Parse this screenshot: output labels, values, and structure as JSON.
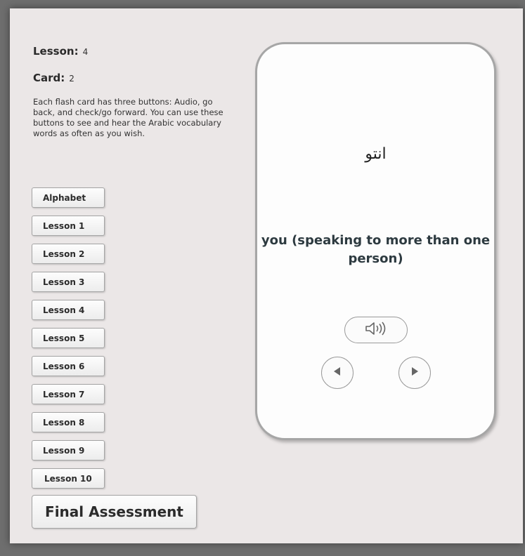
{
  "sidebar": {
    "lesson_label": "Lesson:",
    "lesson_value": "4",
    "card_label": "Card:",
    "card_value": "2",
    "instructions": "Each flash card has three buttons: Audio, go back, and check/go forward. You can use these buttons to see and hear the Arabic vocabulary words as often as you wish.",
    "buttons": [
      "Alphabet",
      "Lesson 1",
      "Lesson 2",
      "Lesson 3",
      "Lesson 4",
      "Lesson 5",
      "Lesson 6",
      "Lesson 7",
      "Lesson 8",
      "Lesson 9",
      "Lesson 10"
    ],
    "final_button": "Final Assessment"
  },
  "card": {
    "arabic": "انتو",
    "english": "you (speaking to more than one person)",
    "audio_icon": "speaker-icon",
    "back_icon": "play-left-icon",
    "forward_icon": "play-right-icon"
  }
}
